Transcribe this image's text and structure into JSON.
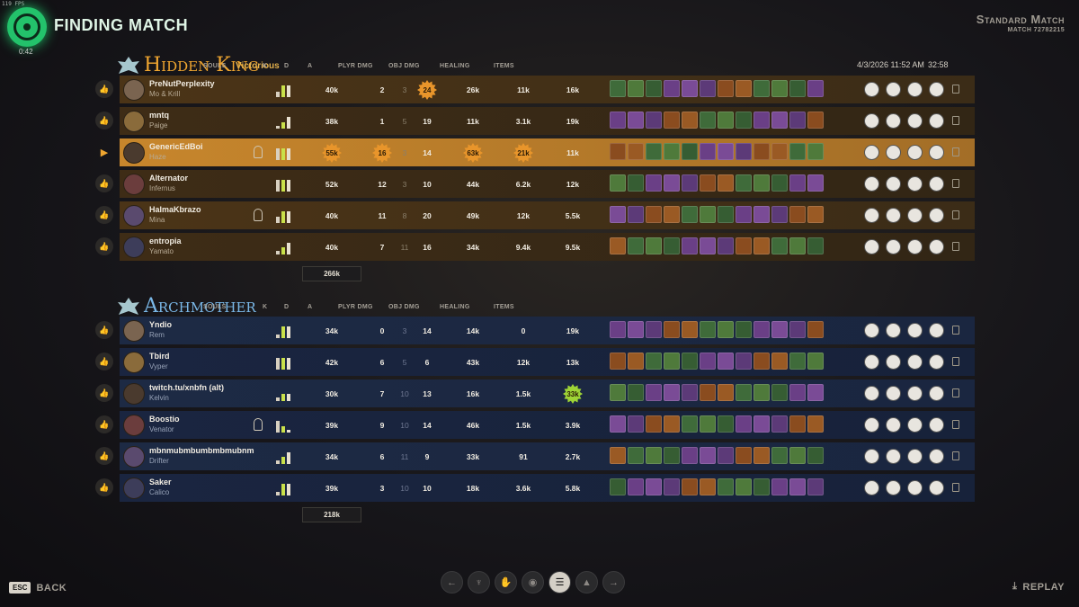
{
  "hud": {
    "fps": "119 FPS",
    "status_title": "FINDING MATCH",
    "queue_timer": "0:42"
  },
  "match": {
    "mode": "Standard Match",
    "match_id": "MATCH 72782215",
    "date_time": "4/3/2026 11:52 AM",
    "duration": "32:58"
  },
  "columns": {
    "souls": "SOULS",
    "k": "K",
    "d": "D",
    "a": "A",
    "player_damage": "PLYR DMG",
    "objective_damage": "OBJ DMG",
    "healing": "HEALING",
    "items": "ITEMS"
  },
  "teams": [
    {
      "name": "Hidden King",
      "result": "Victorious",
      "color": "#f0a630",
      "total_souls": "266k",
      "players": [
        {
          "player": "PreNutPerplexity",
          "hero": "Mo & Krill",
          "souls": "40k",
          "k": "2",
          "d": "3",
          "a": "24",
          "plyr_dmg": "26k",
          "obj_dmg": "11k",
          "healing": "16k",
          "bars": [
            0.4,
            0.9,
            0.9
          ],
          "highlight": [
            "a"
          ]
        },
        {
          "player": "mntq",
          "hero": "Paige",
          "souls": "38k",
          "k": "1",
          "d": "5",
          "a": "19",
          "plyr_dmg": "11k",
          "obj_dmg": "3.1k",
          "healing": "19k",
          "bars": [
            0.2,
            0.5,
            0.9
          ]
        },
        {
          "player": "GenericEdBoi",
          "hero": "Haze",
          "souls": "55k",
          "k": "16",
          "d": "3",
          "a": "14",
          "plyr_dmg": "63k",
          "obj_dmg": "21k",
          "healing": "11k",
          "bars": [
            0.9,
            0.9,
            0.9
          ],
          "highlight": [
            "souls",
            "k",
            "plyr_dmg",
            "obj_dmg"
          ],
          "self": true,
          "rank_icon": "eye-rank-icon"
        },
        {
          "player": "Alternator",
          "hero": "Infernus",
          "souls": "52k",
          "k": "12",
          "d": "3",
          "a": "10",
          "plyr_dmg": "44k",
          "obj_dmg": "6.2k",
          "healing": "12k",
          "bars": [
            0.9,
            0.9,
            0.9
          ]
        },
        {
          "player": "HalmaKbrazo",
          "hero": "Mina",
          "souls": "40k",
          "k": "11",
          "d": "8",
          "a": "20",
          "plyr_dmg": "49k",
          "obj_dmg": "12k",
          "healing": "5.5k",
          "bars": [
            0.5,
            0.9,
            0.9
          ],
          "rank_icon": "keyhole-rank-icon"
        },
        {
          "player": "entropia",
          "hero": "Yamato",
          "souls": "40k",
          "k": "7",
          "d": "11",
          "a": "16",
          "plyr_dmg": "34k",
          "obj_dmg": "9.4k",
          "healing": "9.5k",
          "bars": [
            0.3,
            0.6,
            0.9
          ]
        }
      ]
    },
    {
      "name": "Archmother",
      "result": "",
      "color": "#7ab8e8",
      "total_souls": "218k",
      "players": [
        {
          "player": "Yndio",
          "hero": "Rem",
          "souls": "34k",
          "k": "0",
          "d": "3",
          "a": "14",
          "plyr_dmg": "14k",
          "obj_dmg": "0",
          "healing": "19k",
          "bars": [
            0.3,
            0.9,
            0.9
          ]
        },
        {
          "player": "Tbird",
          "hero": "Vyper",
          "souls": "42k",
          "k": "6",
          "d": "5",
          "a": "6",
          "plyr_dmg": "43k",
          "obj_dmg": "12k",
          "healing": "13k",
          "bars": [
            0.9,
            0.9,
            0.9
          ]
        },
        {
          "player": "twitch.tu/xnbfn (alt)",
          "hero": "Kelvin",
          "souls": "30k",
          "k": "7",
          "d": "10",
          "a": "13",
          "plyr_dmg": "16k",
          "obj_dmg": "1.5k",
          "healing": "33k",
          "bars": [
            0.3,
            0.6,
            0.6
          ],
          "highlight": [
            "healing"
          ]
        },
        {
          "player": "Boostio",
          "hero": "Venator",
          "souls": "39k",
          "k": "9",
          "d": "10",
          "a": "14",
          "plyr_dmg": "46k",
          "obj_dmg": "1.5k",
          "healing": "3.9k",
          "bars": [
            0.9,
            0.5,
            0.2
          ],
          "rank_icon": "keyhole-rank-icon"
        },
        {
          "player": "mbnmubmbumbmbmubnm",
          "hero": "Drifter",
          "souls": "34k",
          "k": "6",
          "d": "11",
          "a": "9",
          "plyr_dmg": "33k",
          "obj_dmg": "91",
          "healing": "2.7k",
          "bars": [
            0.3,
            0.6,
            0.9
          ]
        },
        {
          "player": "Saker",
          "hero": "Calico",
          "souls": "39k",
          "k": "3",
          "d": "10",
          "a": "10",
          "plyr_dmg": "18k",
          "obj_dmg": "3.6k",
          "healing": "5.8k",
          "bars": [
            0.3,
            0.9,
            0.9
          ]
        }
      ]
    }
  ],
  "footer": {
    "esc_key": "ESC",
    "back_label": "BACK",
    "replay_label": "REPLAY",
    "nav_icons": [
      "arrow-left-icon",
      "trophy-icon",
      "hand-icon",
      "bulb-icon",
      "scoreboard-icon",
      "chart-icon",
      "arrow-right-icon"
    ],
    "nav_active_index": 4
  },
  "colors": {
    "item_green": "#3f6b3a",
    "item_purple": "#6a3f86",
    "item_orange": "#8a4c1f",
    "self_row": "#c7862c",
    "highlight_star": "#e8952b",
    "healing_star": "#9ed436"
  }
}
